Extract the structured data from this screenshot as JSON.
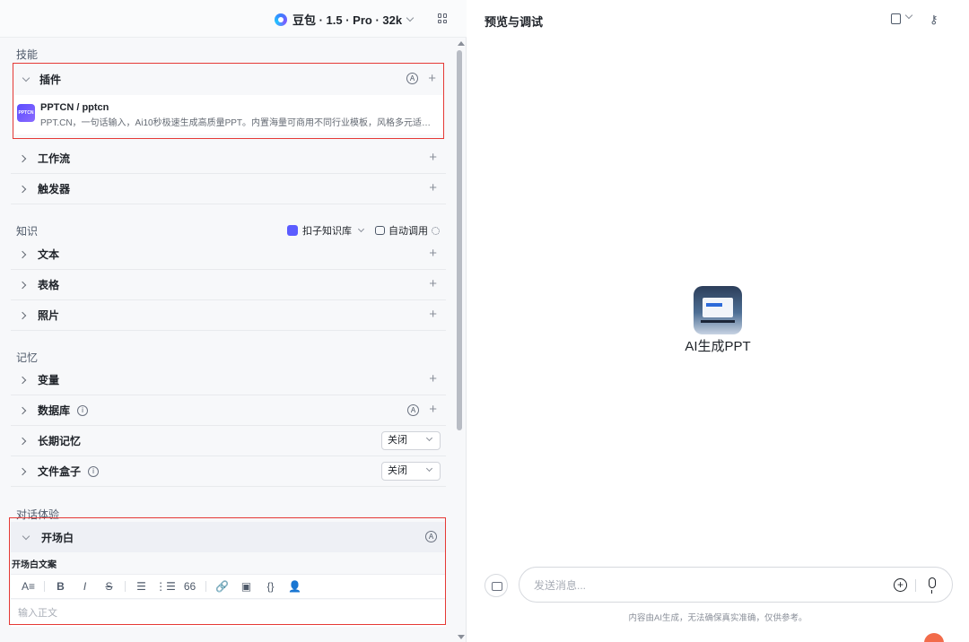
{
  "header": {
    "model_label": "豆包 · 1.5 · Pro · 32k",
    "grid_icon": "grid-icon"
  },
  "skills": {
    "title": "技能",
    "plugin": {
      "label": "插件",
      "items": [
        {
          "name": "PPTCN / pptcn",
          "logo_text": "PPTCN",
          "desc": "PPT.CN，一句话输入，Ai10秒极速生成高质量PPT。内置海量可商用不同行业模板，风格多元适配…"
        }
      ]
    },
    "workflow": {
      "label": "工作流"
    },
    "trigger": {
      "label": "触发器"
    }
  },
  "knowledge": {
    "title": "知识",
    "kb_select": "扣子知识库",
    "auto_call": "自动调用",
    "text": {
      "label": "文本"
    },
    "table": {
      "label": "表格"
    },
    "photo": {
      "label": "照片"
    }
  },
  "memory": {
    "title": "记忆",
    "variable": {
      "label": "变量"
    },
    "database": {
      "label": "数据库"
    },
    "long_term": {
      "label": "长期记忆",
      "value": "关闭"
    },
    "file_box": {
      "label": "文件盒子",
      "value": "关闭"
    }
  },
  "dialog": {
    "title": "对话体验",
    "opening": {
      "label": "开场白",
      "text_label": "开场白文案",
      "placeholder": "输入正文",
      "toolbar": [
        "A≡",
        "B",
        "I",
        "S",
        "☰",
        "⋮☰",
        "66",
        "🔗",
        "▣",
        "{}",
        "👤"
      ]
    }
  },
  "preview": {
    "title": "预览与调试",
    "bot_name": "AI生成PPT",
    "input_placeholder": "发送消息...",
    "disclaimer": "内容由AI生成，无法确保真实准确，仅供参考。"
  },
  "colors": {
    "highlight_border": "#e53935",
    "accent": "#5b5cff"
  }
}
